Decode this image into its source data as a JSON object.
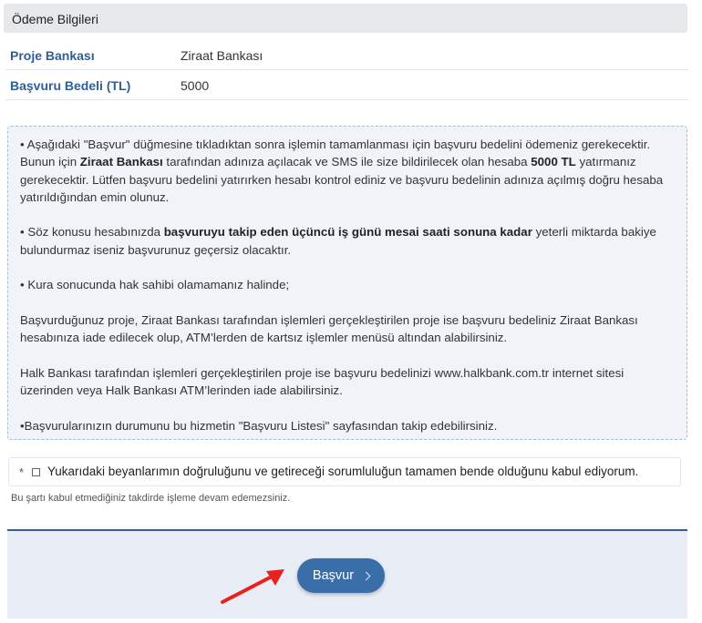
{
  "section": {
    "title": "Ödeme Bilgileri"
  },
  "info": {
    "bank_label": "Proje Bankası",
    "bank_value": "Ziraat Bankası",
    "fee_label": "Başvuru Bedeli (TL)",
    "fee_value": "5000"
  },
  "notice": {
    "p1_a": "• Aşağıdaki \"Başvur\" düğmesine tıkladıktan sonra işlemin tamamlanması için başvuru bedelini ödemeniz gerekecektir. Bunun için ",
    "p1_b": "Ziraat Bankası",
    "p1_c": " tarafından adınıza açılacak ve SMS ile size bildirilecek olan hesaba ",
    "p1_d": "5000 TL",
    "p1_e": " yatırmanız gerekecektir. Lütfen başvuru bedelini yatırırken hesabı kontrol ediniz ve başvuru bedelinin adınıza açılmış doğru hesaba yatırıldığından emin olunuz.",
    "p2_a": "• Söz konusu hesabınızda ",
    "p2_b": "başvuruyu takip eden üçüncü iş günü mesai saati sonuna kadar",
    "p2_c": " yeterli miktarda bakiye bulundurmaz iseniz başvurunuz geçersiz olacaktır.",
    "p3": "• Kura sonucunda hak sahibi olamamanız halinde;",
    "p4": "Başvurduğunuz proje, Ziraat Bankası tarafından işlemleri gerçekleştirilen proje ise başvuru bedeliniz Ziraat Bankası hesabınıza iade edilecek olup, ATM’lerden de kartsız işlemler menüsü altından alabilirsiniz.",
    "p5": "Halk Bankası tarafından işlemleri gerçekleştirilen proje ise başvuru bedelinizi www.halkbank.com.tr internet sitesi üzerinden veya Halk Bankası ATM’lerinden iade alabilirsiniz.",
    "p6": "•Başvurularınızın durumunu bu hizmetin \"Başvuru Listesi\" sayfasından takip edebilirsiniz."
  },
  "consent": {
    "required_mark": "*",
    "text": "Yukarıdaki beyanlarımın doğruluğunu ve getireceği sorumluluğun tamamen bende olduğunu kabul ediyorum.",
    "checked": false
  },
  "hint": "Bu şartı kabul etmediğiniz takdirde işleme devam edemezsiniz.",
  "actions": {
    "apply_label": "Başvur",
    "apply_icon": "chevron-right-icon"
  },
  "annotation": {
    "arrow_color": "#e8231f",
    "arrow_icon": "red-arrow-icon"
  },
  "colors": {
    "accent": "#3a6ea8",
    "label": "#2e5f96",
    "notice_bg": "#f0f4f8",
    "footer_bg": "#e9eef6"
  }
}
